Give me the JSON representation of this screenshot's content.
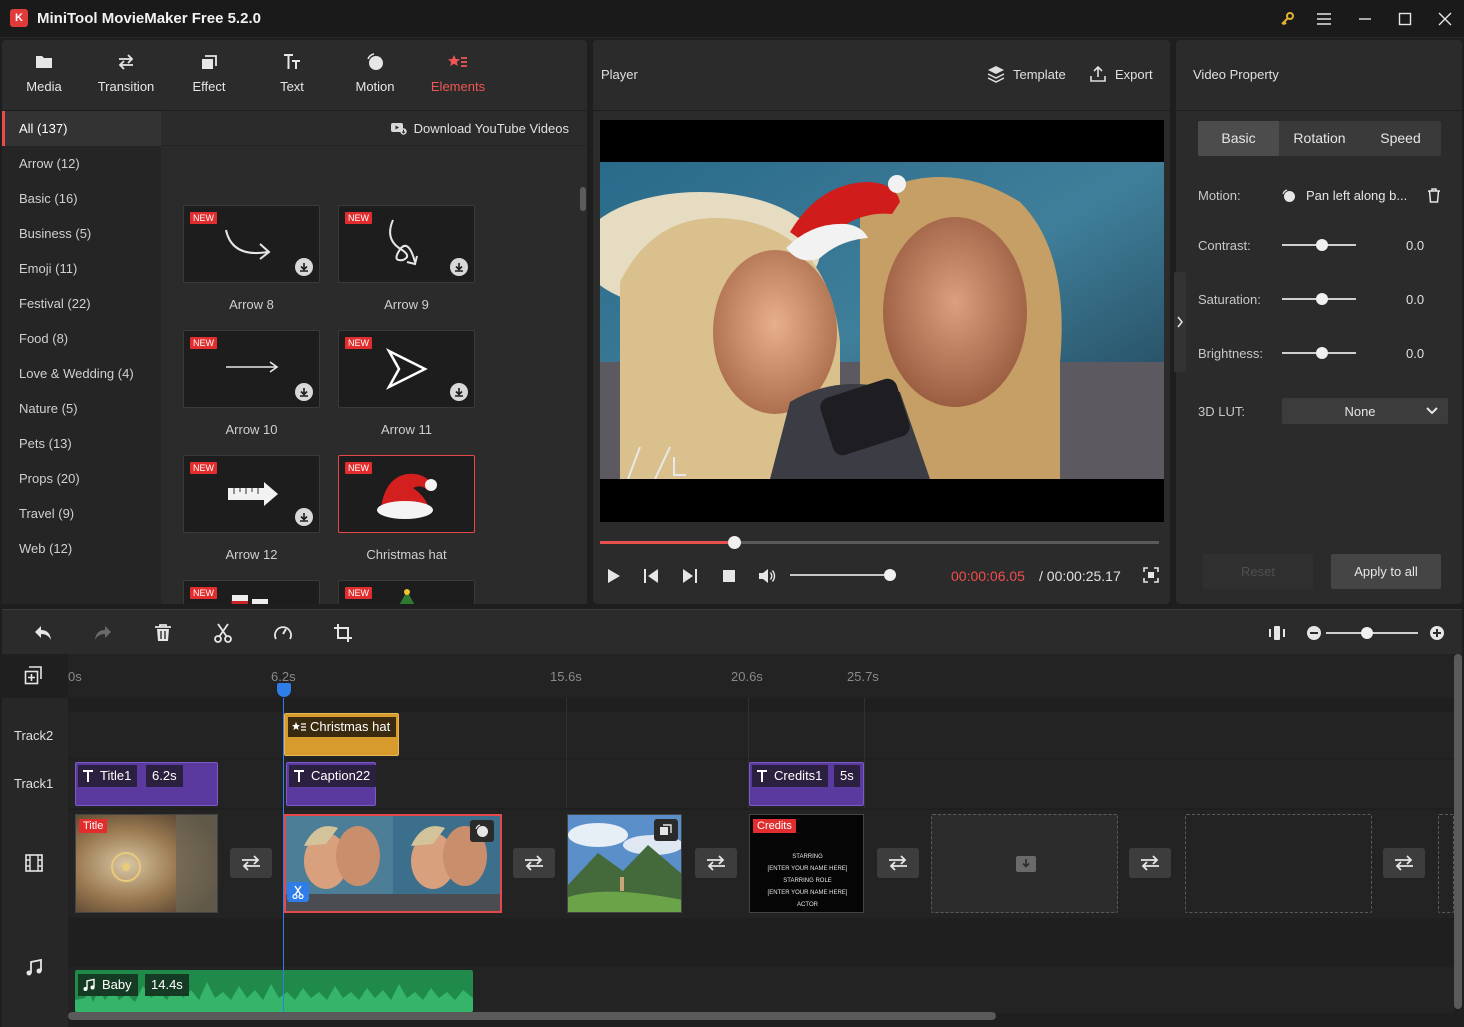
{
  "window": {
    "title": "MiniTool MovieMaker Free 5.2.0",
    "logo_text": "K"
  },
  "toolbar": {
    "items": [
      {
        "label": "Media",
        "icon": "folder-icon"
      },
      {
        "label": "Transition",
        "icon": "transition-arrows-icon"
      },
      {
        "label": "Effect",
        "icon": "effect-layers-icon"
      },
      {
        "label": "Text",
        "icon": "text-tt-icon"
      },
      {
        "label": "Motion",
        "icon": "motion-circle-icon"
      },
      {
        "label": "Elements",
        "icon": "elements-star-icon",
        "active": true
      }
    ]
  },
  "categories": [
    {
      "label": "All (137)",
      "active": true
    },
    {
      "label": "Arrow (12)"
    },
    {
      "label": "Basic (16)"
    },
    {
      "label": "Business (5)"
    },
    {
      "label": "Emoji (11)"
    },
    {
      "label": "Festival (22)"
    },
    {
      "label": "Food (8)"
    },
    {
      "label": "Love & Wedding (4)"
    },
    {
      "label": "Nature (5)"
    },
    {
      "label": "Pets (13)"
    },
    {
      "label": "Props (20)"
    },
    {
      "label": "Travel (9)"
    },
    {
      "label": "Web (12)"
    }
  ],
  "media_grid": {
    "download_youtube": "Download YouTube Videos",
    "badge": "NEW",
    "items": [
      {
        "label": "Arrow 8",
        "icon": "curved-arrow-icon"
      },
      {
        "label": "Arrow 9",
        "icon": "loop-arrow-icon"
      },
      {
        "label": "Arrow 10",
        "icon": "straight-arrow-icon"
      },
      {
        "label": "Arrow 11",
        "icon": "triangle-arrow-icon"
      },
      {
        "label": "Arrow 12",
        "icon": "ruler-arrow-icon"
      },
      {
        "label": "Christmas hat",
        "icon": "santa-hat-icon",
        "selected": true
      },
      {
        "label": "",
        "icon": "christmas-stocking-icon"
      },
      {
        "label": "",
        "icon": "christmas-tree-icon"
      }
    ]
  },
  "player": {
    "title": "Player",
    "template_label": "Template",
    "export_label": "Export",
    "time_current": "00:00:06.05",
    "time_total": "/ 00:00:25.17",
    "progress": 0.24,
    "volume": 1.0
  },
  "property": {
    "title": "Video Property",
    "tabs": [
      "Basic",
      "Rotation",
      "Speed"
    ],
    "active_tab": "Basic",
    "motion_label": "Motion:",
    "motion_value": "Pan left along b...",
    "contrast_label": "Contrast:",
    "contrast_value": "0.0",
    "saturation_label": "Saturation:",
    "saturation_value": "0.0",
    "brightness_label": "Brightness:",
    "brightness_value": "0.0",
    "lut_label": "3D LUT:",
    "lut_value": "None",
    "reset_label": "Reset",
    "apply_label": "Apply to all"
  },
  "timeline": {
    "ruler_ticks": [
      "0s",
      "6.2s",
      "15.6s",
      "20.6s",
      "25.7s"
    ],
    "tracks": [
      "Track2",
      "Track1"
    ],
    "element_clip": "Christmas hat",
    "text_clips": [
      {
        "label": "Title1",
        "duration": "6.2s"
      },
      {
        "label": "Caption22",
        "duration": ""
      },
      {
        "label": "Credits1",
        "duration": "5s"
      }
    ],
    "video_clips": [
      {
        "badge": "Title"
      },
      {
        "badge": ""
      },
      {
        "badge": ""
      },
      {
        "badge": "Credits",
        "lines": [
          "STARRING",
          "[ENTER YOUR NAME HERE]",
          "STARRING ROLE",
          "[ENTER YOUR NAME HERE]",
          "ACTOR"
        ]
      }
    ],
    "audio_clip": {
      "label": "Baby",
      "duration": "14.4s"
    }
  },
  "colors": {
    "accent_red": "#e84d4d",
    "text_clip": "#5a3a9e",
    "element_clip": "#d79a2c",
    "audio_clip": "#1f8a4a",
    "playhead": "#2e7de9"
  }
}
